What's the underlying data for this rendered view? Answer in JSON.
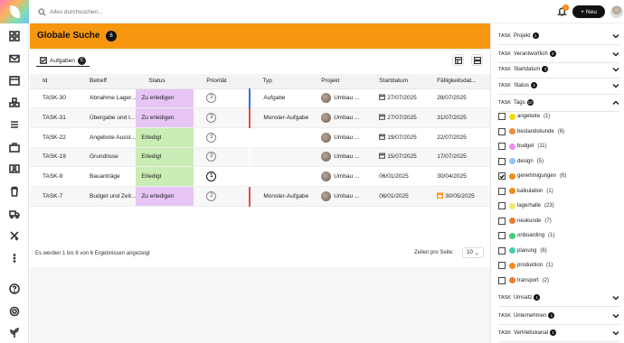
{
  "search": {
    "placeholder": "Alles durchsuchen..."
  },
  "topbar": {
    "notification_count": "5",
    "new_label": "Neu"
  },
  "banner": {
    "title": "Globale Suche",
    "count": "6"
  },
  "tab": {
    "label": "Aufgaben",
    "count": "6"
  },
  "table": {
    "headers": [
      "Id",
      "Betreff",
      "Status",
      "Priorität",
      "Typ",
      "Projekt",
      "Startdatum",
      "Fälligkeitsdat..."
    ],
    "rows": [
      {
        "id": "TASK-30",
        "subject": "Abnahme Lager...",
        "status": "Zu erledigen",
        "status_kind": "open",
        "priority": "3",
        "type": "Aufgabe",
        "project": "Umbau ...",
        "start": "27/07/2025",
        "due": "28/07/2025",
        "start_icon": true,
        "due_icon": false,
        "due_warn": false
      },
      {
        "id": "TASK-31",
        "subject": "Übergabe und I...",
        "status": "Zu erledigen",
        "status_kind": "open",
        "priority": "3",
        "type": "Monster-Aufgabe",
        "project": "Umbau ...",
        "start": "27/07/2025",
        "due": "31/07/2025",
        "start_icon": true,
        "due_icon": false,
        "due_warn": false
      },
      {
        "id": "TASK-22",
        "subject": "Angebote Ausst...",
        "status": "Erledigt",
        "status_kind": "done",
        "priority": "3",
        "type": "",
        "project": "Umbau ...",
        "start": "19/07/2025",
        "due": "22/07/2025",
        "start_icon": true,
        "due_icon": false,
        "due_warn": false
      },
      {
        "id": "TASK-19",
        "subject": "Grundrisse",
        "status": "Erledigt",
        "status_kind": "done",
        "priority": "3",
        "type": "",
        "project": "Umbau ...",
        "start": "15/07/2025",
        "due": "17/07/2025",
        "start_icon": true,
        "due_icon": false,
        "due_warn": false
      },
      {
        "id": "TASK-9",
        "subject": "Bauanträge",
        "status": "Erledigt",
        "status_kind": "done",
        "priority": "1",
        "type": "",
        "project": "Umbau ...",
        "start": "06/01/2025",
        "due": "30/04/2025",
        "start_icon": false,
        "due_icon": false,
        "due_warn": false
      },
      {
        "id": "TASK-7",
        "subject": "Budget und Zeit...",
        "status": "Zu erledigen",
        "status_kind": "open",
        "priority": "2",
        "type": "Monster-Aufgabe",
        "project": "Umbau ...",
        "start": "06/01/2025",
        "due": "30/05/2025",
        "start_icon": false,
        "due_icon": true,
        "due_warn": true
      }
    ]
  },
  "footer": {
    "info": "Es werden 1 bis 6 von 6 Ergebnissen angezeigt",
    "per_page_label": "Zeilen pro Seite:",
    "per_page_value": "10"
  },
  "filters": {
    "prefix": "TASK",
    "top_sections": [
      {
        "label": "Projekt",
        "count": "1"
      },
      {
        "label": "Verantwortlich",
        "count": "3"
      },
      {
        "label": "Startdatum",
        "count": "3"
      },
      {
        "label": "Status",
        "count": "2"
      },
      {
        "label": "Tags",
        "count": "10"
      }
    ],
    "tags": [
      {
        "name": "angebote",
        "count": "(1)",
        "color": "#f5d90a",
        "checked": false
      },
      {
        "name": "bestandskunde",
        "count": "(6)",
        "color": "#f08a3a",
        "checked": false
      },
      {
        "name": "budget",
        "count": "(11)",
        "color": "#e98ff0",
        "checked": false
      },
      {
        "name": "design",
        "count": "(5)",
        "color": "#8fc2ff",
        "checked": false
      },
      {
        "name": "genehmigungen",
        "count": "(6)",
        "color": "#f58a12",
        "checked": true
      },
      {
        "name": "kalkulation",
        "count": "(1)",
        "color": "#f58a12",
        "checked": false
      },
      {
        "name": "lagerhalle",
        "count": "(23)",
        "color": "#f5e86a",
        "checked": false
      },
      {
        "name": "neukunde",
        "count": "(7)",
        "color": "#f07a2a",
        "checked": false
      },
      {
        "name": "onboarding",
        "count": "(1)",
        "color": "#3fcf7a",
        "checked": false
      },
      {
        "name": "planung",
        "count": "(6)",
        "color": "#3fcfb0",
        "checked": false
      },
      {
        "name": "produktion",
        "count": "(1)",
        "color": "#f58a12",
        "checked": false
      },
      {
        "name": "transport",
        "count": "(2)",
        "color": "#f07a2a",
        "checked": false
      }
    ],
    "bottom_sections": [
      {
        "label": "Umsatz",
        "count": "1"
      },
      {
        "label": "Unternehmen",
        "count": "1"
      },
      {
        "label": "Vertriebskanal",
        "count": "1"
      }
    ]
  }
}
